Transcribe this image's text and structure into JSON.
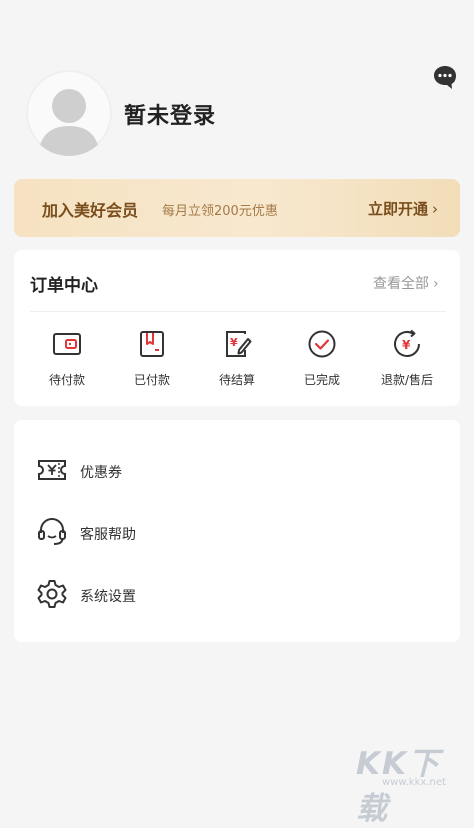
{
  "header": {
    "login_status": "暂未登录"
  },
  "member": {
    "title": "加入美好会员",
    "subtitle": "每月立领200元优惠",
    "action": "立即开通"
  },
  "orders": {
    "title": "订单中心",
    "view_all": "查看全部",
    "items": [
      {
        "label": "待付款",
        "icon": "wallet-icon"
      },
      {
        "label": "已付款",
        "icon": "receipt-icon"
      },
      {
        "label": "待结算",
        "icon": "yuan-edit-icon"
      },
      {
        "label": "已完成",
        "icon": "check-circle-icon"
      },
      {
        "label": "退款/售后",
        "icon": "refund-icon"
      }
    ]
  },
  "services": [
    {
      "label": "优惠券",
      "icon": "coupon-icon"
    },
    {
      "label": "客服帮助",
      "icon": "headset-icon"
    },
    {
      "label": "系统设置",
      "icon": "settings-gear-icon"
    }
  ],
  "colors": {
    "accent": "#e0363a",
    "member_text": "#7a4e1c",
    "gold_bg": "#f6e2c1"
  },
  "watermark": {
    "title": "KK下载",
    "url": "www.kkx.net"
  }
}
